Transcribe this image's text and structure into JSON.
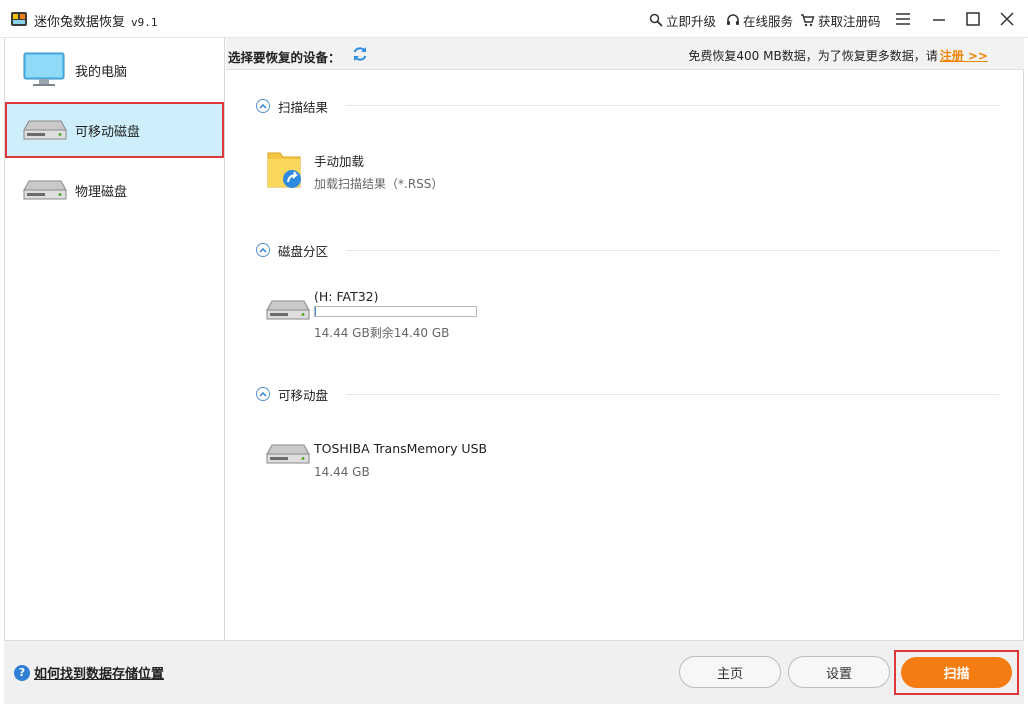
{
  "window": {
    "title": "迷你兔数据恢复",
    "version": "v9.1",
    "links": {
      "upgrade": "立即升级",
      "online_service": "在线服务",
      "get_code": "获取注册码"
    }
  },
  "sidebar": {
    "items": [
      {
        "label": "我的电脑",
        "icon": "monitor-icon"
      },
      {
        "label": "可移动磁盘",
        "icon": "removable-disk-icon",
        "active": true
      },
      {
        "label": "物理磁盘",
        "icon": "physical-disk-icon"
      }
    ]
  },
  "header": {
    "title": "选择要恢复的设备：",
    "notice": "免费恢复400 MB数据，为了恢复更多数据，请",
    "register_link": "注册 >>"
  },
  "sections": {
    "scan_results": {
      "title": "扫描结果",
      "entry_name": "手动加载",
      "entry_sub": "加载扫描结果（*.RSS）"
    },
    "partitions": {
      "title": "磁盘分区",
      "entry_name": "(H: FAT32)",
      "usage_fraction": 0.003,
      "entry_sub": "14.44 GB剩余14.40 GB"
    },
    "removable": {
      "title": "可移动盘",
      "entry_name": "TOSHIBA TransMemory USB",
      "entry_sub": "14.44 GB"
    }
  },
  "bottom": {
    "help_text": "如何找到数据存储位置",
    "home_label": "主页",
    "settings_label": "设置",
    "scan_label": "扫描"
  },
  "colors": {
    "accent_orange": "#f57c12",
    "highlight_red": "#e0373a",
    "active_bg": "#cdeefa",
    "link_blue": "#2f7fd6"
  }
}
